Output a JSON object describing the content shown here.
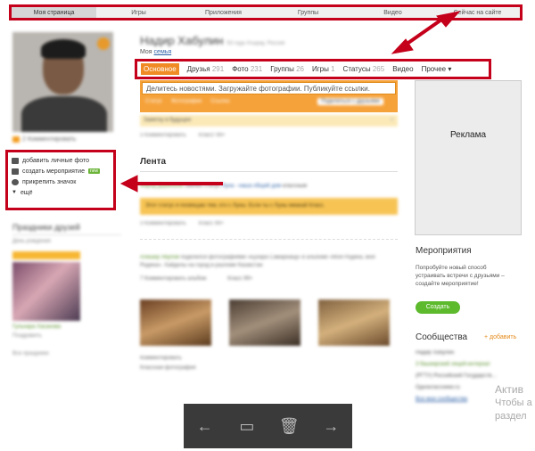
{
  "topnav": {
    "items": [
      "Моя страница",
      "Игры",
      "Приложения",
      "Группы",
      "Видео",
      "Сейчас на сайте"
    ],
    "active_index": 0
  },
  "profile": {
    "name": "Надир Хабулин",
    "name_small": "53 года Атырау, Россия",
    "sub_prefix": "Моя",
    "sub_link": "семья",
    "comments": "2 Комментировать"
  },
  "actions": {
    "add_photo": "добавить личные фото",
    "create_event": "создать мероприятие",
    "new_tag": "new",
    "pin_badge": "прикрепить значок",
    "more": "ещё"
  },
  "tabs": [
    {
      "label": "Основное",
      "count": ""
    },
    {
      "label": "Друзья",
      "count": "291"
    },
    {
      "label": "Фото",
      "count": "231"
    },
    {
      "label": "Группы",
      "count": "26"
    },
    {
      "label": "Игры",
      "count": "1"
    },
    {
      "label": "Статусы",
      "count": "265"
    },
    {
      "label": "Видео",
      "count": ""
    },
    {
      "label": "Прочее ▾",
      "count": ""
    }
  ],
  "status_box": {
    "placeholder": "Делитесь новостями. Загружайте фотографии. Публикуйте ссылки.",
    "status": "Статус",
    "photo": "Фотографии",
    "link": "Ссылка",
    "share": "Поделиться с друзьями"
  },
  "note": "Заметку в будущее",
  "post1": {
    "comments": "3 Комментировать",
    "likes": "Класс! 99+"
  },
  "feed": {
    "title": "Лента",
    "author": "Фарид Дервишев",
    "action": "сменил статус",
    "group": "Луна - наша общий дом",
    "tag": "классным",
    "status_text": "Этот статус я посвящаю тем, кто с Луны. Если ты с Луны жмакай Класс.",
    "comments": "3 Комментировать",
    "likes": "Класс 99+"
  },
  "feed2": {
    "author": "Алишер Якупов",
    "text": "поделился фотографиями «Бухара Самарканд» в альбоме «Моя Родина, моя Родина». Хайдилы на город в разломе Казакстан",
    "comments": "7 Комментировать альбом",
    "likes": "Класс 99+",
    "row2": "Комментировать",
    "row3": "Классная фотография"
  },
  "left_lower": {
    "title": "Праздники друзей",
    "sub": "День рождения",
    "name": "Гульнара Хасанова",
    "link": "Поздравить",
    "more": "Все праздники"
  },
  "ad_label": "Реклама",
  "events": {
    "title": "Мероприятия",
    "text": "Попробуйте новый способ устраивать встречи с друзьями – создайте мероприятие!",
    "button": "Создать"
  },
  "communities": {
    "title": "Сообщества",
    "add": "+ добавить",
    "items": [
      "Надир Хабулин",
      "3 башкирский лицей-интернат",
      "(РГТУ) Российский Государств…",
      "Одноклассники.ru"
    ],
    "all": "Все мои сообщества"
  },
  "watermark": {
    "line1": "Актив",
    "line2": "Чтобы а",
    "line3": "раздел"
  },
  "viewer": {
    "prev": "←",
    "slideshow": "▭",
    "delete": "🗑",
    "next": "→"
  },
  "colors": {
    "annotation": "#c4001a",
    "accent": "#f08a24",
    "green": "#5cba2c"
  }
}
